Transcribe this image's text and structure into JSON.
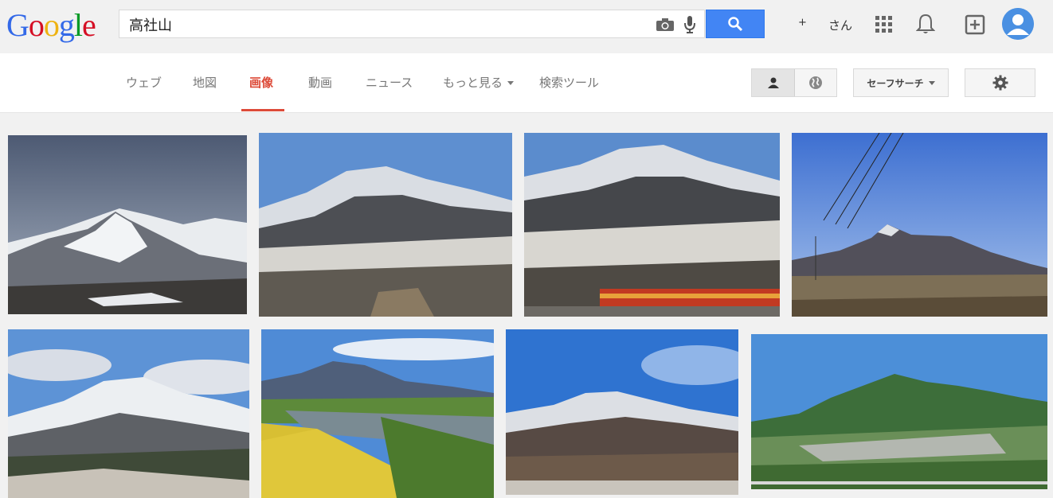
{
  "logo": {
    "letters": [
      "G",
      "o",
      "o",
      "g",
      "l",
      "e"
    ],
    "colors": [
      "#3369e8",
      "#d50f25",
      "#eeb211",
      "#3369e8",
      "#009925",
      "#d50f25"
    ]
  },
  "search": {
    "query": "高社山"
  },
  "header": {
    "plus_label": "+",
    "user_name": "さん"
  },
  "nav": {
    "tabs": [
      {
        "label": "ウェブ"
      },
      {
        "label": "地図"
      },
      {
        "label": "画像"
      },
      {
        "label": "動画"
      },
      {
        "label": "ニュース"
      },
      {
        "label": "もっと見る"
      },
      {
        "label": "検索ツール"
      }
    ],
    "active_tab": "画像"
  },
  "tools": {
    "safesearch_label": "セーフサーチ"
  },
  "colors": {
    "accent": "#dd4b39",
    "search_button": "#4285f4"
  },
  "results": [
    {
      "name": "snowy-mountain-ski-slopes"
    },
    {
      "name": "snow-capped-mountain-over-town"
    },
    {
      "name": "mountain-with-red-train"
    },
    {
      "name": "mountain-with-power-lines"
    },
    {
      "name": "snowy-peak-with-clouds"
    },
    {
      "name": "mountain-over-river-and-rice-fields"
    },
    {
      "name": "snowy-ridge-blue-sky"
    },
    {
      "name": "green-mountain-over-valley"
    }
  ]
}
